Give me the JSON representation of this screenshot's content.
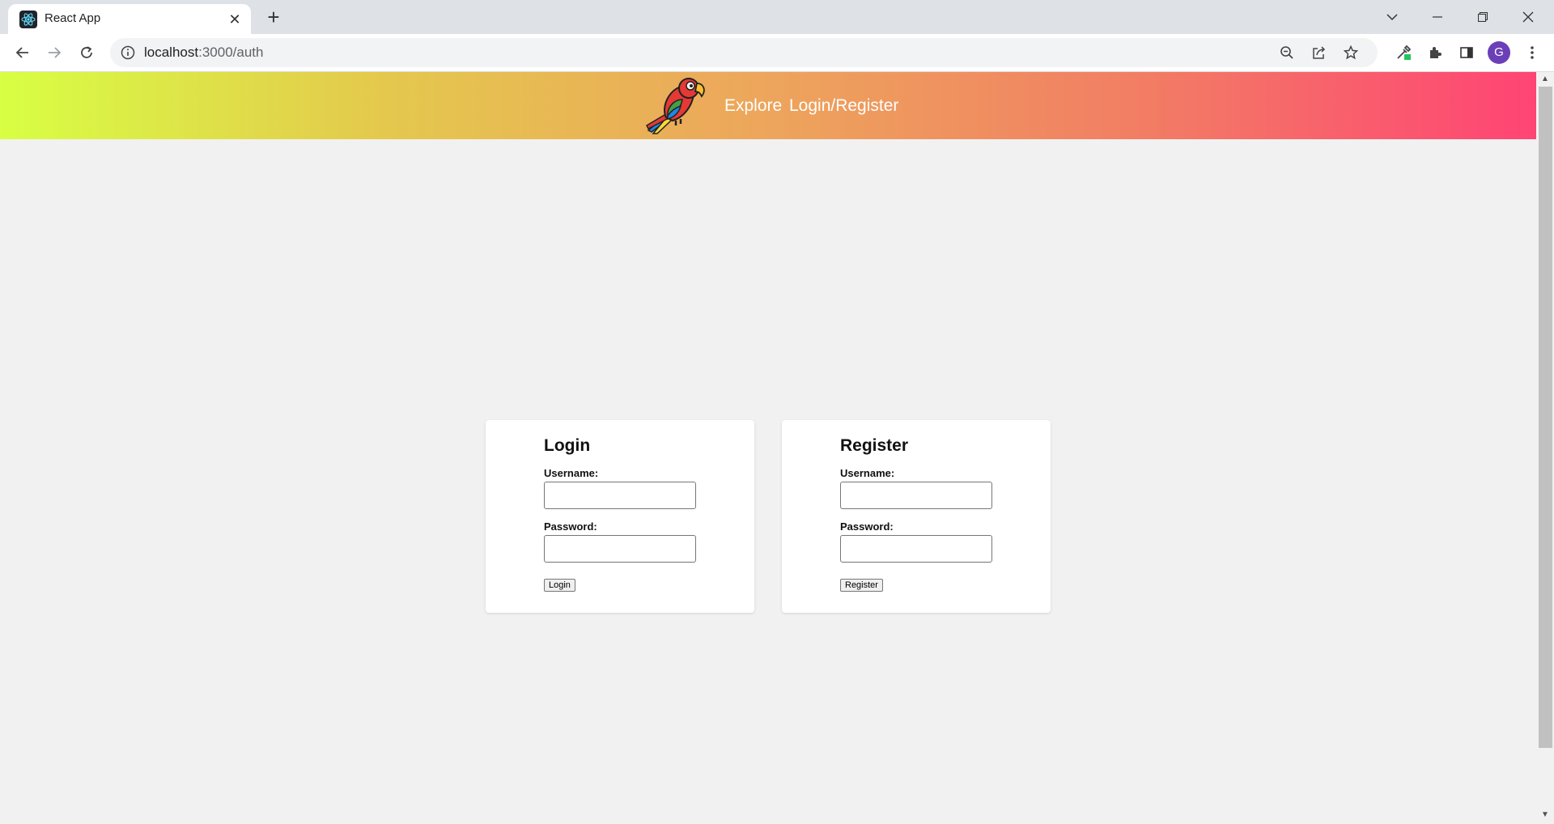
{
  "browser": {
    "tab_title": "React App",
    "address": {
      "host": "localhost",
      "port_path": ":3000/auth"
    },
    "profile_initial": "G"
  },
  "nav": {
    "links": [
      "Explore",
      "Login/Register"
    ]
  },
  "login": {
    "title": "Login",
    "username_label": "Username:",
    "password_label": "Password:",
    "button_label": "Login"
  },
  "register": {
    "title": "Register",
    "username_label": "Username:",
    "password_label": "Password:",
    "button_label": "Register"
  },
  "colors": {
    "header_gradient_start": "#d8ff43",
    "header_gradient_end": "#ff4474",
    "page_background": "#f1f1f1",
    "card_background": "#ffffff"
  },
  "icons": {
    "logo": "parrot-icon",
    "tab_favicon": "react-icon"
  }
}
